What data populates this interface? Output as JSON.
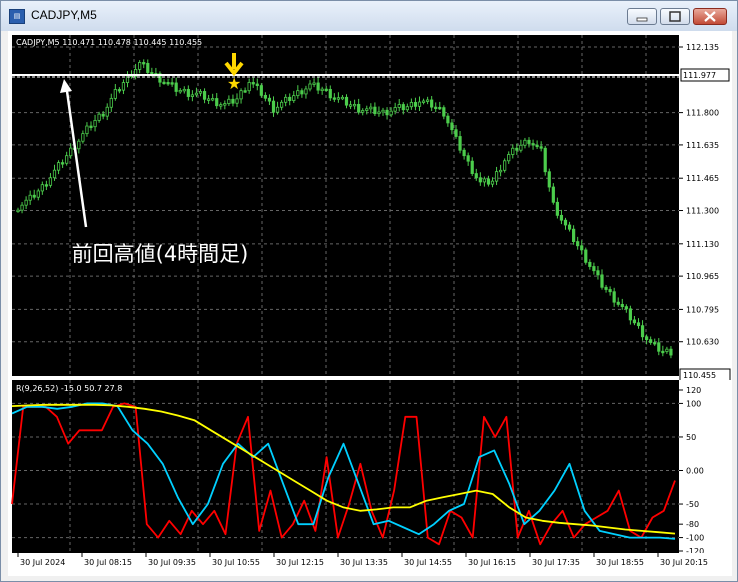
{
  "window": {
    "title": "CADJPY,M5"
  },
  "main_chart": {
    "header": "CADJPY,M5  110.471 110.478 110.445 110.455",
    "price_ticks": [
      "112.135",
      "111.800",
      "111.635",
      "111.465",
      "111.300",
      "111.130",
      "110.965",
      "110.795",
      "110.630"
    ],
    "hline_label": "111.977",
    "bid_label": "110.455",
    "annotation": "前回高値(4時間足)"
  },
  "indicator": {
    "header": "R(9,26,52) -15.0 50.7 27.8",
    "ticks": [
      "120",
      "100",
      "50",
      "0.00",
      "-50",
      "-80",
      "-100",
      "-120"
    ]
  },
  "time_axis": [
    "30 Jul 2024",
    "30 Jul 08:15",
    "30 Jul 09:35",
    "30 Jul 10:55",
    "30 Jul 12:15",
    "30 Jul 13:35",
    "30 Jul 14:55",
    "30 Jul 16:15",
    "30 Jul 17:35",
    "30 Jul 18:55",
    "30 Jul 20:15"
  ],
  "chart_data": {
    "type": "line",
    "price": {
      "y_range": [
        110.455,
        112.135
      ],
      "close": [
        111.32,
        111.36,
        111.42,
        111.5,
        111.58,
        111.66,
        111.74,
        111.8,
        111.9,
        111.98,
        112.05,
        112.0,
        111.96,
        111.92,
        111.9,
        111.89,
        111.86,
        111.84,
        111.87,
        111.96,
        111.9,
        111.82,
        111.86,
        111.9,
        111.94,
        111.92,
        111.88,
        111.85,
        111.82,
        111.81,
        111.8,
        111.82,
        111.83,
        111.86,
        111.84,
        111.8,
        111.66,
        111.54,
        111.44,
        111.45,
        111.56,
        111.62,
        111.66,
        111.6,
        111.33,
        111.22,
        111.12,
        111.02,
        110.92,
        110.85,
        110.78,
        110.7,
        110.62,
        110.58
      ]
    },
    "indicator": {
      "y_range": [
        -120,
        120
      ],
      "series": [
        {
          "color": "#ff0000",
          "values": [
            -50,
            95,
            95,
            95,
            80,
            40,
            60,
            60,
            60,
            95,
            100,
            95,
            -80,
            -100,
            -75,
            -95,
            -60,
            -80,
            -60,
            -95,
            40,
            80,
            -90,
            -30,
            -100,
            -80,
            -45,
            -90,
            20,
            -100,
            -50,
            10,
            -60,
            -100,
            -30,
            80,
            80,
            -100,
            -110,
            -60,
            -70,
            -100,
            80,
            50,
            80,
            -100,
            -60,
            -110,
            -80,
            -60,
            -100,
            -80,
            -70,
            -60,
            -30,
            -90,
            -100,
            -70,
            -60,
            -15
          ]
        },
        {
          "color": "#00d0ff",
          "values": [
            85,
            95,
            95,
            92,
            95,
            100,
            100,
            96,
            60,
            40,
            10,
            -40,
            -80,
            -50,
            10,
            40,
            20,
            40,
            -20,
            -80,
            -80,
            -10,
            40,
            -20,
            -80,
            -75,
            -85,
            -95,
            -80,
            -60,
            -50,
            20,
            30,
            -20,
            -80,
            -60,
            -30,
            10,
            -60,
            -90,
            -95,
            -100,
            -100,
            -100,
            -102
          ]
        },
        {
          "color": "#ffff00",
          "values": [
            96,
            97,
            98,
            98,
            98,
            98,
            97,
            95,
            92,
            88,
            82,
            75,
            60,
            45,
            30,
            15,
            0,
            -15,
            -30,
            -45,
            -55,
            -60,
            -58,
            -55,
            -55,
            -45,
            -40,
            -35,
            -30,
            -35,
            -55,
            -70,
            -75,
            -78,
            -80,
            -82,
            -85,
            -88,
            -90,
            -92,
            -94
          ]
        }
      ]
    }
  }
}
